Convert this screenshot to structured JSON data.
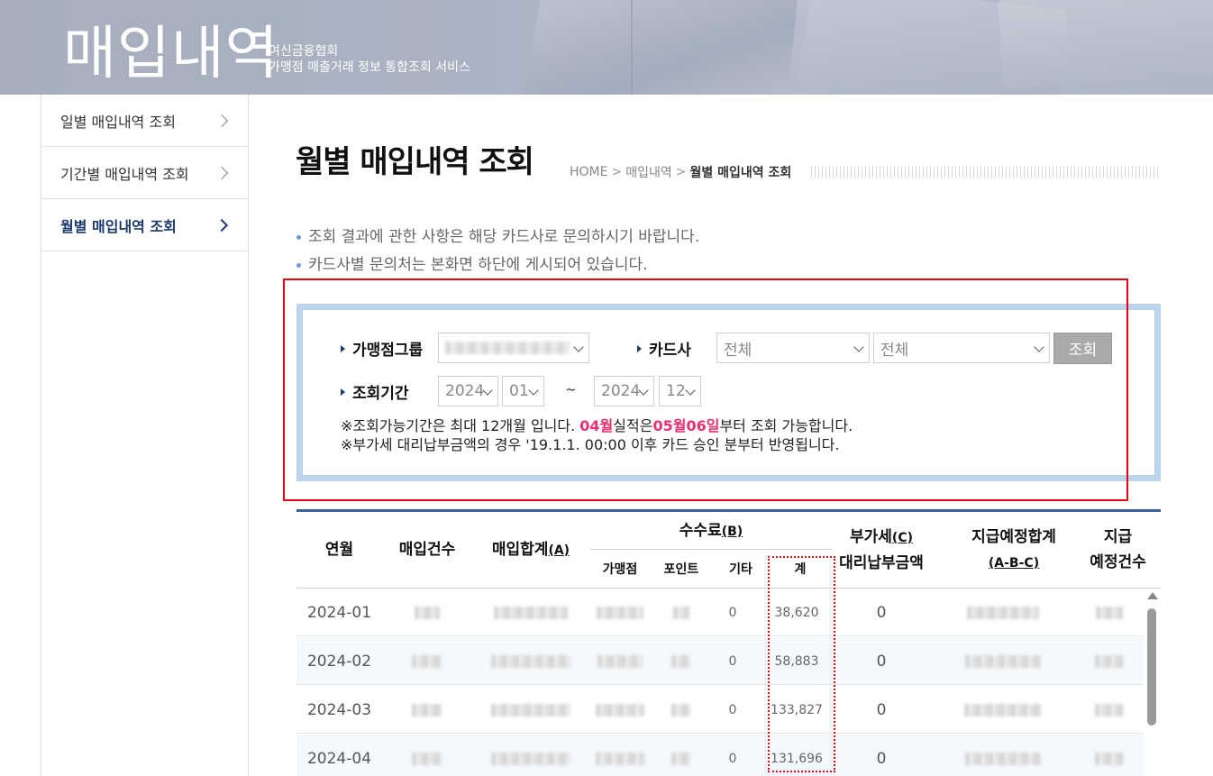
{
  "banner": {
    "title": "매입내역",
    "org": "여신금융협회",
    "service": "가맹점 매출거래 정보 통합조회 서비스"
  },
  "sidebar": {
    "items": [
      {
        "label": "일별 매입내역 조회",
        "active": false
      },
      {
        "label": "기간별 매입내역 조회",
        "active": false
      },
      {
        "label": "월별 매입내역 조회",
        "active": true
      }
    ]
  },
  "page": {
    "title": "월별 매입내역 조회",
    "breadcrumb": [
      "HOME",
      "매입내역",
      "월별 매입내역 조회"
    ],
    "notes": [
      "조회 결과에 관한 사항은 해당 카드사로 문의하시기 바랍니다.",
      "카드사별 문의처는 본화면 하단에 게시되어 있습니다."
    ]
  },
  "search": {
    "group_label": "가맹점그룹",
    "card_label": "카드사",
    "card_select_1": "전체",
    "card_select_2": "전체",
    "button": "조회",
    "period_label": "조회기간",
    "from_year": "2024",
    "from_month": "01",
    "tilde": "~",
    "to_year": "2024",
    "to_month": "12",
    "info_line1_a": "※조회가능기간은 최대 12개월 입니다. ",
    "info_line1_month": "04월",
    "info_line1_b": "실적은",
    "info_line1_date": "05월06일",
    "info_line1_c": "부터 조회 가능합니다.",
    "info_line2": "※부가세 대리납부금액의 경우 '19.1.1. 00:00 이후 카드 승인 분부터 반영됩니다."
  },
  "table": {
    "headers": {
      "month": "연월",
      "count": "매입건수",
      "total": "매입합계",
      "total_mark": "(A)",
      "fee": "수수료",
      "fee_mark": "(B)",
      "fee_merchant": "가맹점",
      "fee_point": "포인트",
      "fee_other": "기타",
      "fee_sum": "계",
      "vat": "부가세",
      "vat_mark": "(C)",
      "vat_sub": "대리납부금액",
      "payout": "지급예정합계",
      "payout_sub": "(A-B-C)",
      "pay_count_1": "지급",
      "pay_count_2": "예정건수"
    },
    "rows": [
      {
        "month": "2024-01",
        "other": "0",
        "fee_sum": "38,620",
        "vat": "0"
      },
      {
        "month": "2024-02",
        "other": "0",
        "fee_sum": "58,883",
        "vat": "0"
      },
      {
        "month": "2024-03",
        "other": "0",
        "fee_sum": "133,827",
        "vat": "0"
      },
      {
        "month": "2024-04",
        "other": "0",
        "fee_sum": "131,696",
        "vat": "0"
      }
    ]
  },
  "colors": {
    "accent_navy": "#1c3a6b",
    "highlight_pink": "#e8316e",
    "annotation_red": "#e30613",
    "search_border": "#bcd3ee"
  }
}
